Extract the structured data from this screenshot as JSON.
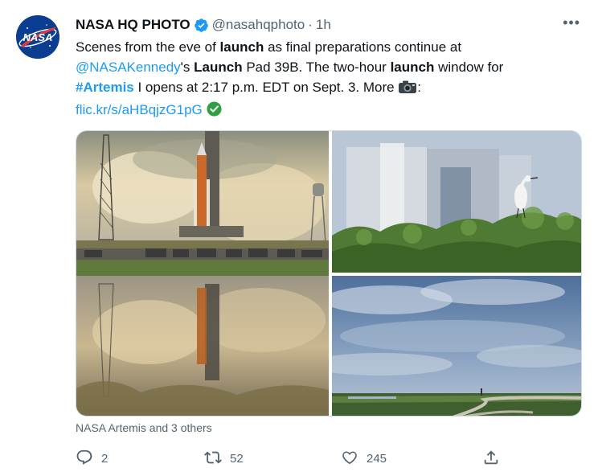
{
  "tweet": {
    "author_name": "NASA HQ PHOTO",
    "handle": "@nasahqphoto",
    "separator": "·",
    "time": "1h",
    "more": "•••",
    "text": {
      "p1": "Scenes from the eve of ",
      "launch1": "launch",
      "p2": " as final preparations continue at",
      "mention": "@NASAKennedy",
      "p3": "'s ",
      "launch2": "Launch",
      "p4": " Pad 39B. The two-hour ",
      "launch3": "launch",
      "p5": " window for",
      "hashtag": "#Artemis",
      "p6": " I opens at 2:17 p.m. EDT on Sept. 3. More ",
      "p7": ":",
      "url": "flic.kr/s/aHBqjzG1pG"
    },
    "tagged": "NASA Artemis and 3 others",
    "actions": {
      "replies": "2",
      "retweets": "52",
      "likes": "245"
    }
  },
  "colors": {
    "link": "#1d9bf0",
    "secondary_text": "#536471",
    "verified": "#1d9bf0",
    "check_emoji": "#2ea043",
    "nasa_blue": "#0b3d91"
  },
  "icons": {
    "verified": "verified-badge-icon",
    "camera": "camera-emoji-icon",
    "check": "check-mark-emoji-icon",
    "reply": "reply-icon",
    "retweet": "retweet-icon",
    "like": "heart-icon",
    "share": "share-icon"
  }
}
